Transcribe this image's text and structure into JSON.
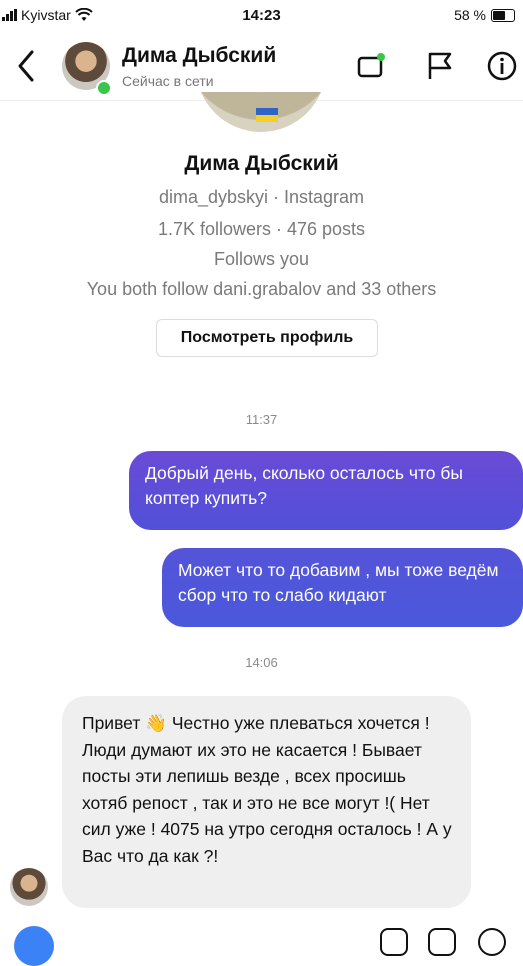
{
  "status_bar": {
    "carrier": "Kyivstar",
    "time": "14:23",
    "battery": "58 %"
  },
  "header": {
    "name": "Дима Дыбский",
    "status": "Сейчас в сети"
  },
  "profile": {
    "name": "Дима Дыбский",
    "handle": "dima_dybskyi · Instagram",
    "stats": "1.7K followers · 476 posts",
    "follows": "Follows you",
    "mutual": "You both follow dani.grabalov and 33 others",
    "view_button": "Посмотреть профиль"
  },
  "messages": {
    "time_1": "11:37",
    "outgoing_1": "Добрый день, сколько осталось что бы коптер купить?",
    "outgoing_2": "Может что то добавим , мы тоже ведём сбор что то слабо кидают",
    "time_2": "14:06",
    "incoming_1": "Привет 👋 Честно уже плеваться хочется ! Люди думают их это не касается ! Бывает посты эти лепишь везде , всех просишь хотяб репост , так и это не все могут !( Нет сил уже ! 4075 на утро сегодня осталось ! А у Вас что да как ?!"
  },
  "colors": {
    "accent_purple": "#6a4bd6",
    "accent_blue": "#4a58dc",
    "online": "#3ac64a"
  }
}
